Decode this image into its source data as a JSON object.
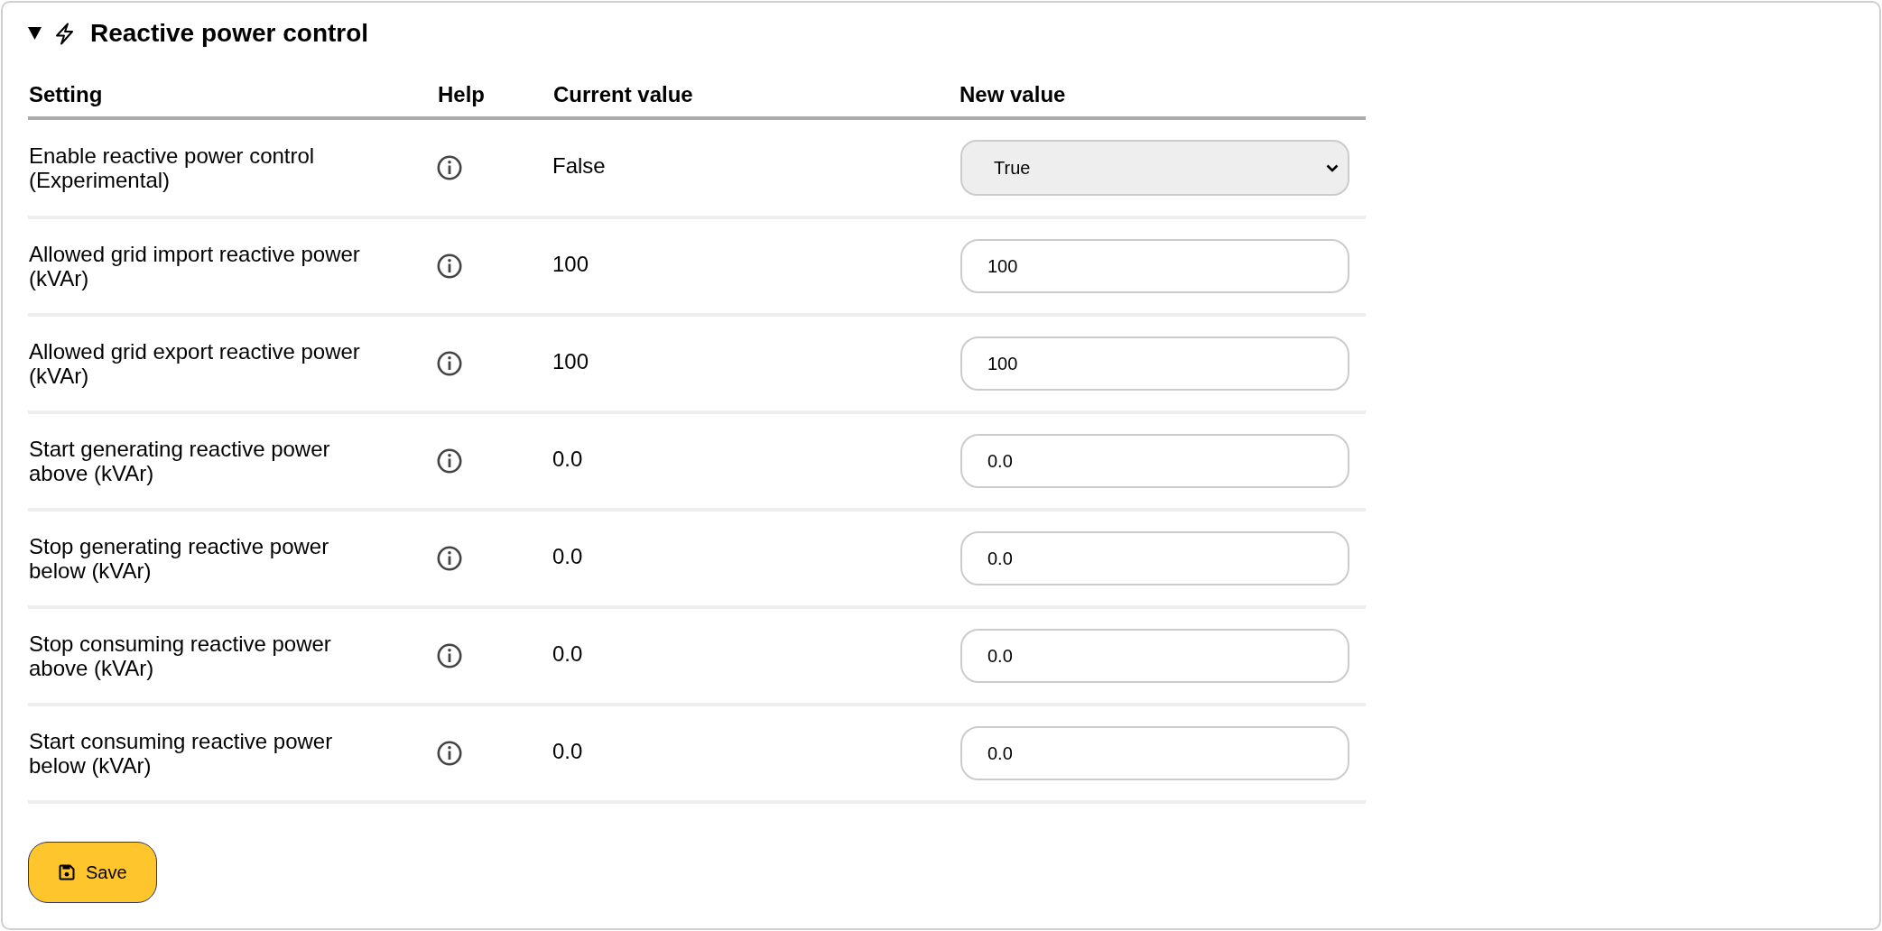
{
  "section": {
    "title": "Reactive power control",
    "expanded": true
  },
  "table": {
    "columns": [
      "Setting",
      "Help",
      "Current value",
      "New value"
    ],
    "rows": [
      {
        "setting": "Enable reactive power control (Experimental)",
        "current_value": "False",
        "new_value": {
          "kind": "select",
          "value": "True"
        }
      },
      {
        "setting": "Allowed grid import reactive power (kVAr)",
        "current_value": "100",
        "new_value": {
          "kind": "input",
          "value": "100"
        }
      },
      {
        "setting": "Allowed grid export reactive power (kVAr)",
        "current_value": "100",
        "new_value": {
          "kind": "input",
          "value": "100"
        }
      },
      {
        "setting": "Start generating reactive power above (kVAr)",
        "current_value": "0.0",
        "new_value": {
          "kind": "input",
          "value": "0.0"
        }
      },
      {
        "setting": "Stop generating reactive power below (kVAr)",
        "current_value": "0.0",
        "new_value": {
          "kind": "input",
          "value": "0.0"
        }
      },
      {
        "setting": "Stop consuming reactive power above (kVAr)",
        "current_value": "0.0",
        "new_value": {
          "kind": "input",
          "value": "0.0"
        }
      },
      {
        "setting": "Start consuming reactive power below (kVAr)",
        "current_value": "0.0",
        "new_value": {
          "kind": "input",
          "value": "0.0"
        }
      }
    ]
  },
  "save_button": {
    "label": "Save"
  }
}
